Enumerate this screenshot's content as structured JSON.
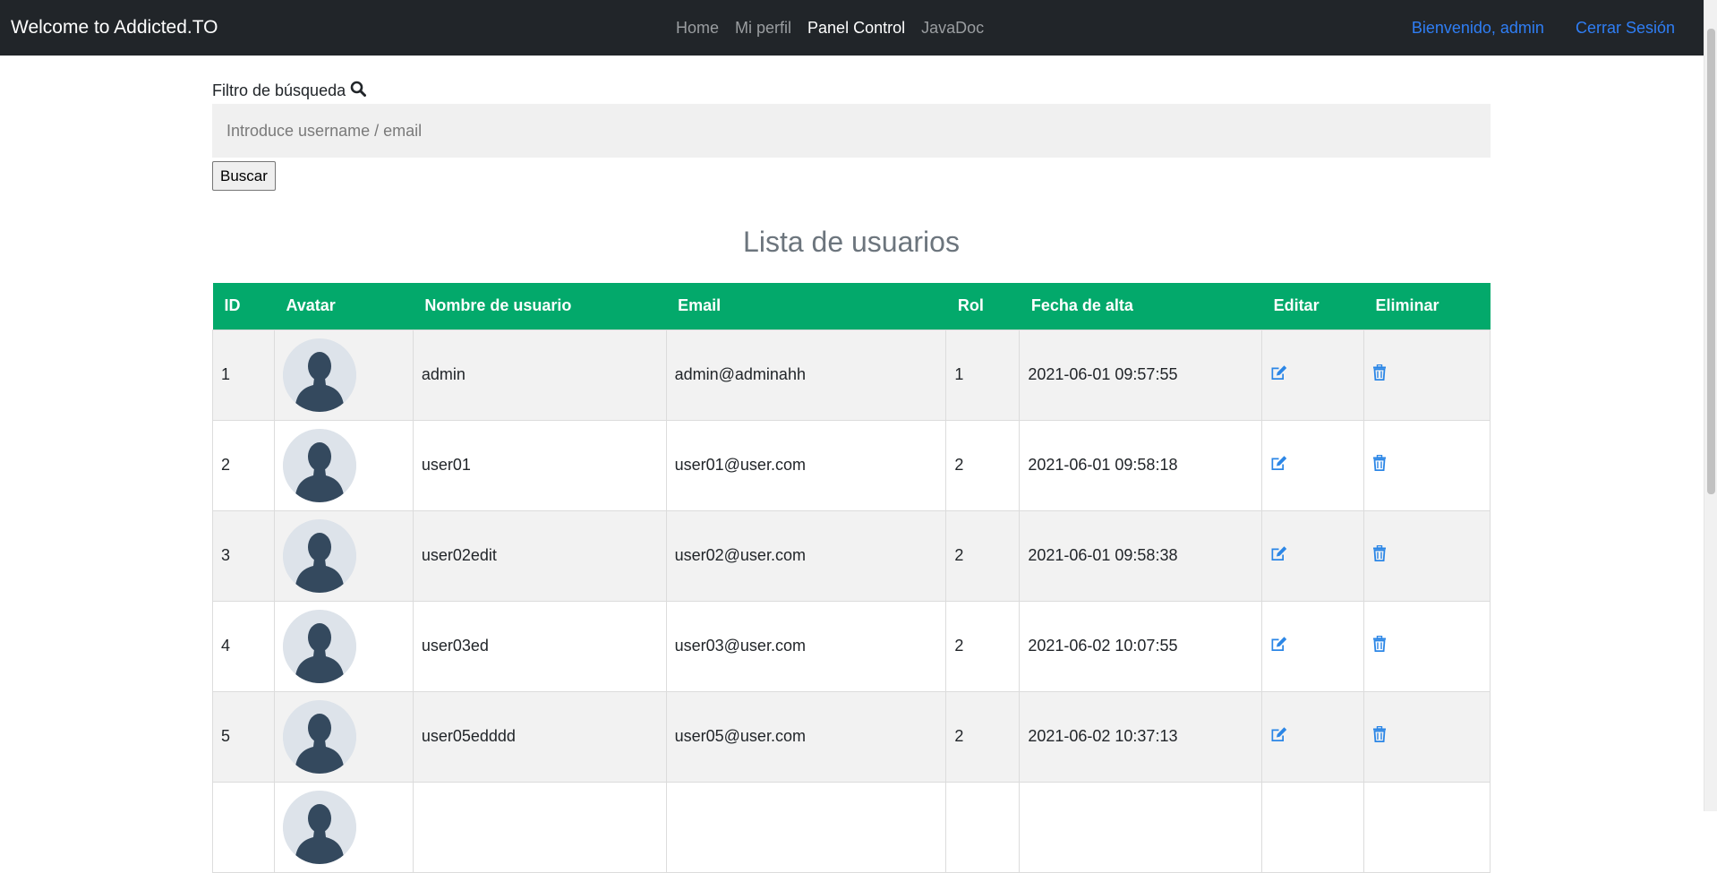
{
  "navbar": {
    "brand": "Welcome to Addicted.TO",
    "links": [
      "Home",
      "Mi perfil",
      "Panel Control",
      "JavaDoc"
    ],
    "active": "Panel Control",
    "welcome": "Bienvenido, admin",
    "logout": "Cerrar Sesión"
  },
  "search": {
    "label": "Filtro de búsqueda",
    "placeholder": "Introduce username / email",
    "value": "",
    "button": "Buscar"
  },
  "list_title": "Lista de usuarios",
  "table": {
    "columns": [
      "ID",
      "Avatar",
      "Nombre de usuario",
      "Email",
      "Rol",
      "Fecha de alta",
      "Editar",
      "Eliminar"
    ],
    "rows": [
      {
        "id": "1",
        "username": "admin",
        "email": "admin@adminahh",
        "rol": "1",
        "fecha": "2021-06-01 09:57:55"
      },
      {
        "id": "2",
        "username": "user01",
        "email": "user01@user.com",
        "rol": "2",
        "fecha": "2021-06-01 09:58:18"
      },
      {
        "id": "3",
        "username": "user02edit",
        "email": "user02@user.com",
        "rol": "2",
        "fecha": "2021-06-01 09:58:38"
      },
      {
        "id": "4",
        "username": "user03ed",
        "email": "user03@user.com",
        "rol": "2",
        "fecha": "2021-06-02 10:07:55"
      },
      {
        "id": "5",
        "username": "user05edddd",
        "email": "user05@user.com",
        "rol": "2",
        "fecha": "2021-06-02 10:37:13"
      },
      {
        "id": "",
        "username": "",
        "email": "",
        "rol": "",
        "fecha": ""
      }
    ]
  },
  "colors": {
    "navbar_bg": "#212529",
    "header_green": "#03a96b",
    "link_blue": "#2f7ef5",
    "icon_blue": "#2b86e6"
  },
  "icons": {
    "search": "search-icon",
    "edit": "edit-icon",
    "delete": "trash-icon",
    "avatar": "user-silhouette-icon"
  }
}
